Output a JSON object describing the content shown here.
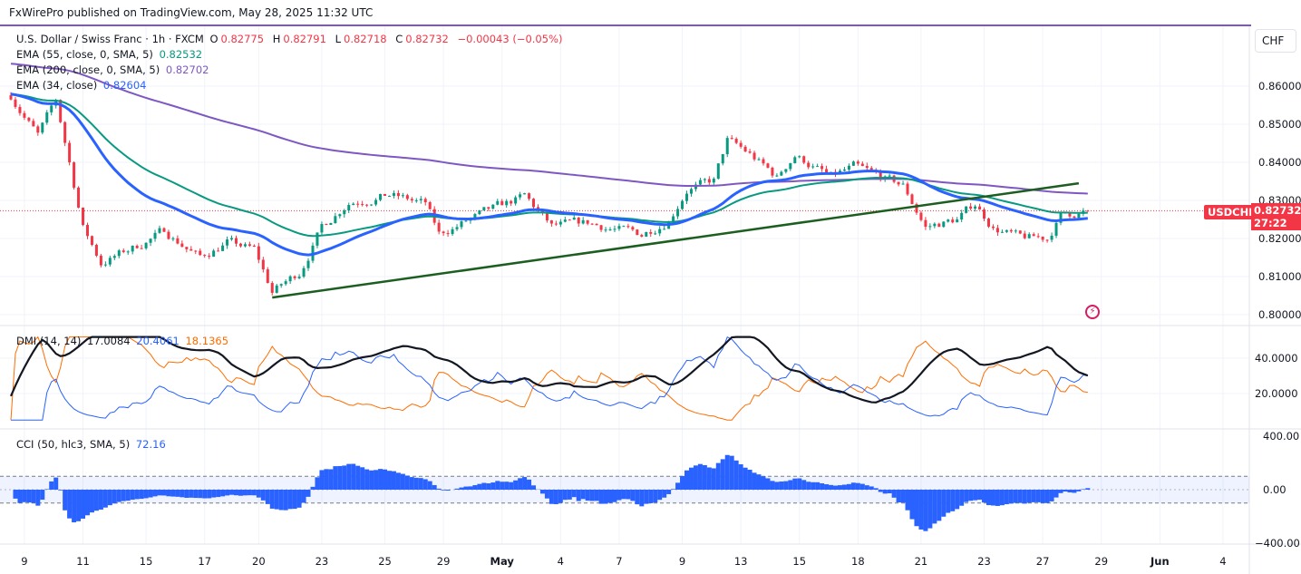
{
  "header": {
    "published": "FxWirePro published on TradingView.com, May 28, 2025 11:32 UTC"
  },
  "symbol": {
    "name": "U.S. Dollar / Swiss Franc · 1h · FXCM",
    "o_label": "O",
    "o": "0.82775",
    "h_label": "H",
    "h": "0.82791",
    "l_label": "L",
    "l": "0.82718",
    "c_label": "C",
    "c": "0.82732",
    "change": "−0.00043 (−0.05%)"
  },
  "indicators": [
    {
      "label": "EMA (55, close, 0, SMA, 5)",
      "value": "0.82532",
      "color": "#089981"
    },
    {
      "label": "EMA (200, close, 0, SMA, 5)",
      "value": "0.82702",
      "color": "#7e57c2"
    },
    {
      "label": "EMA (34, close)",
      "value": "0.82604",
      "color": "#2962ff"
    }
  ],
  "dmi": {
    "label": "DMI (14, 14)",
    "adx": "17.0084",
    "plus_di": "20.4061",
    "minus_di": "18.1365"
  },
  "cci": {
    "label": "CCI (50, hlc3, SMA, 5)",
    "value": "72.16"
  },
  "price_axis": {
    "currency": "CHF",
    "ticker_tag": "USDCHF",
    "last_price": "0.82732",
    "countdown": "27:22"
  },
  "chart_data": {
    "type": "candlestick",
    "symbol": "USDCHF",
    "timeframe": "1h",
    "ylim": [
      0.8,
      0.86
    ],
    "y_ticks": [
      "0.86000",
      "0.85000",
      "0.84000",
      "0.83000",
      "0.82000",
      "0.81000",
      "0.80000"
    ],
    "y_tick_values": [
      0.86,
      0.85,
      0.84,
      0.83,
      0.82,
      0.81,
      0.8
    ],
    "x_ticks": [
      {
        "label": "9",
        "bar": 3
      },
      {
        "label": "11",
        "bar": 16
      },
      {
        "label": "15",
        "bar": 30
      },
      {
        "label": "17",
        "bar": 43
      },
      {
        "label": "20",
        "bar": 55
      },
      {
        "label": "23",
        "bar": 69
      },
      {
        "label": "25",
        "bar": 83
      },
      {
        "label": "29",
        "bar": 96
      },
      {
        "label": "May",
        "bar": 109,
        "bold": true
      },
      {
        "label": "4",
        "bar": 122
      },
      {
        "label": "7",
        "bar": 135
      },
      {
        "label": "9",
        "bar": 149
      },
      {
        "label": "13",
        "bar": 162
      },
      {
        "label": "15",
        "bar": 175
      },
      {
        "label": "18",
        "bar": 188
      },
      {
        "label": "21",
        "bar": 202
      },
      {
        "label": "23",
        "bar": 216
      },
      {
        "label": "27",
        "bar": 229
      },
      {
        "label": "29",
        "bar": 242
      },
      {
        "label": "Jun",
        "bar": 255,
        "bold": true
      },
      {
        "label": "4",
        "bar": 269
      }
    ],
    "bars": 240,
    "close_path": [
      [
        0,
        0.8576
      ],
      [
        6,
        0.847
      ],
      [
        10,
        0.856
      ],
      [
        13,
        0.84
      ],
      [
        16,
        0.823
      ],
      [
        20,
        0.8136
      ],
      [
        28,
        0.818
      ],
      [
        34,
        0.822
      ],
      [
        42,
        0.815
      ],
      [
        48,
        0.819
      ],
      [
        54,
        0.817
      ],
      [
        58,
        0.806
      ],
      [
        64,
        0.811
      ],
      [
        69,
        0.823
      ],
      [
        75,
        0.8297
      ],
      [
        84,
        0.8314
      ],
      [
        92,
        0.829
      ],
      [
        95,
        0.821
      ],
      [
        102,
        0.825
      ],
      [
        114,
        0.831
      ],
      [
        120,
        0.823
      ],
      [
        128,
        0.824
      ],
      [
        140,
        0.821
      ],
      [
        146,
        0.825
      ],
      [
        150,
        0.833
      ],
      [
        156,
        0.835
      ],
      [
        159,
        0.8457
      ],
      [
        164,
        0.842
      ],
      [
        170,
        0.836
      ],
      [
        174,
        0.842
      ],
      [
        182,
        0.836
      ],
      [
        187,
        0.8386
      ],
      [
        198,
        0.8338
      ],
      [
        203,
        0.823
      ],
      [
        210,
        0.825
      ],
      [
        214,
        0.829
      ],
      [
        218,
        0.823
      ],
      [
        224,
        0.82
      ],
      [
        230,
        0.82
      ],
      [
        233,
        0.826
      ],
      [
        239,
        0.8273
      ]
    ],
    "trendline": [
      [
        58,
        0.8045
      ],
      [
        237,
        0.8345
      ]
    ],
    "dmi_ylim": [
      0,
      55
    ],
    "dmi_ticks": [
      "40.0000",
      "20.0000"
    ],
    "dmi_tick_values": [
      40,
      20
    ],
    "cci_ylim": [
      -400,
      400
    ],
    "cci_ticks": [
      "400.00",
      "0.00",
      "-400.00"
    ],
    "cci_tick_values": [
      400,
      0,
      -400
    ],
    "cci_bands": [
      100,
      -100
    ],
    "colors": {
      "up": "#089981",
      "down": "#f23645",
      "ema34": "#2962ff",
      "ema55": "#089981",
      "ema200": "#7e57c2",
      "trend": "#1b5e20",
      "adx": "#131722",
      "plus_di": "#2962ff",
      "minus_di": "#ff6d00",
      "cci": "#2962ff"
    }
  }
}
